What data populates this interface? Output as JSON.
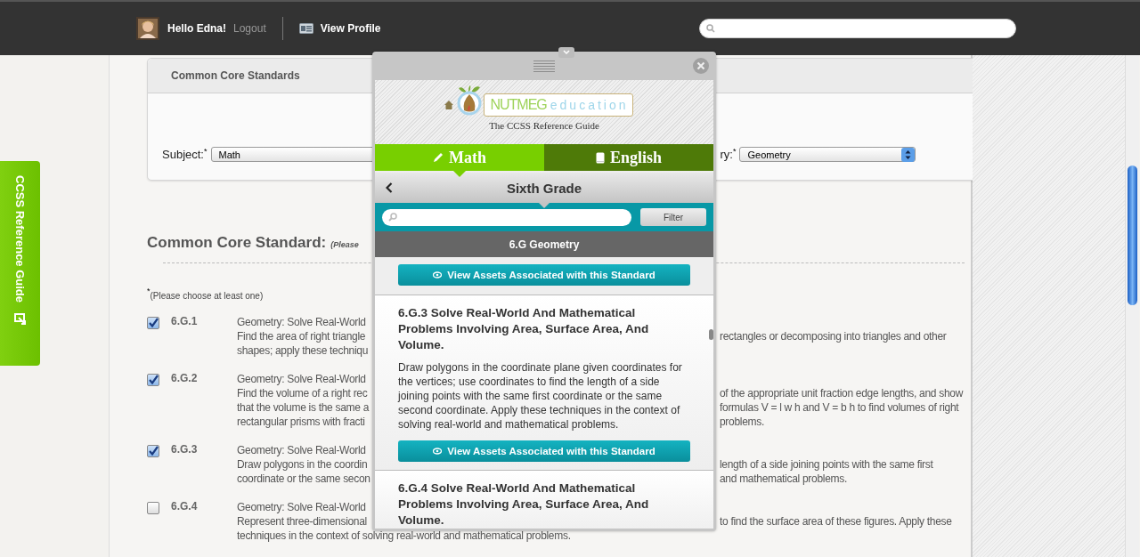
{
  "header": {
    "greeting": "Hello Edna!",
    "logout": "Logout",
    "profile_link": "View Profile"
  },
  "side_tab": {
    "label": "CCSS Reference Guide"
  },
  "standards_panel": {
    "title": "Common Core Standards",
    "subject": {
      "label": "Subject:",
      "required_mark": "*",
      "value": "Math"
    },
    "category": {
      "label": "ry:",
      "required_mark": "*",
      "value": "Geometry"
    }
  },
  "standards": {
    "heading": "Common Core Standard:",
    "heading_note": "(Please",
    "required_mark": "*",
    "hint": "(Please choose at least one)",
    "rows": [
      {
        "code": "6.G.1",
        "checked": true,
        "lines": [
          {
            "left": "Geometry: Solve Real-World"
          },
          {
            "left": "Find the area of right triangle",
            "right": "rectangles or decomposing into triangles and other"
          },
          {
            "left": "shapes; apply these techniqu"
          }
        ]
      },
      {
        "code": "6.G.2",
        "checked": true,
        "lines": [
          {
            "left": "Geometry: Solve Real-World"
          },
          {
            "left": "Find the volume of a right rec",
            "right": "of the appropriate unit fraction edge lengths, and show"
          },
          {
            "left": "that the volume is the same a",
            "right": "formulas V = l w h and V = b h to find volumes of right"
          },
          {
            "left": "rectangular prisms with fracti",
            "right": "problems."
          }
        ]
      },
      {
        "code": "6.G.3",
        "checked": true,
        "lines": [
          {
            "left": "Geometry: Solve Real-World"
          },
          {
            "left": "Draw polygons in the coordin",
            "right": "length of a side joining points with the same first"
          },
          {
            "left": "coordinate or the same secon",
            "right": "and mathematical problems."
          }
        ]
      },
      {
        "code": "6.G.4",
        "checked": false,
        "lines": [
          {
            "left": "Geometry: Solve Real-World"
          },
          {
            "left": "Represent three-dimensional",
            "right": "to find the surface area of these figures. Apply these"
          },
          {
            "left": "techniques in the context of solving real-world and mathematical problems."
          }
        ]
      }
    ]
  },
  "popup": {
    "logo_name": "NUTMEG",
    "logo_suffix": "education",
    "tagline": "The CCSS Reference Guide",
    "tabs": [
      {
        "label": "Math",
        "selected": true
      },
      {
        "label": "English",
        "selected": false
      }
    ],
    "grade": "Sixth Grade",
    "filter_button": "Filter",
    "section": "6.G Geometry",
    "items": [
      {
        "button": "View Assets Associated with this Standard"
      },
      {
        "title": "6.G.3 Solve Real-World And Mathematical Problems Involving Area, Surface Area, And Volume.",
        "description": "Draw polygons in the coordinate plane given coordinates for the vertices; use coordinates to find the length of a side joining points with the same first coordinate or the same second coordinate. Apply these techniques in the context of solving real-world and mathematical problems.",
        "button": "View Assets Associated with this Standard"
      },
      {
        "title": "6.G.4 Solve Real-World And Mathematical Problems Involving Area, Surface Area, And Volume."
      }
    ]
  }
}
